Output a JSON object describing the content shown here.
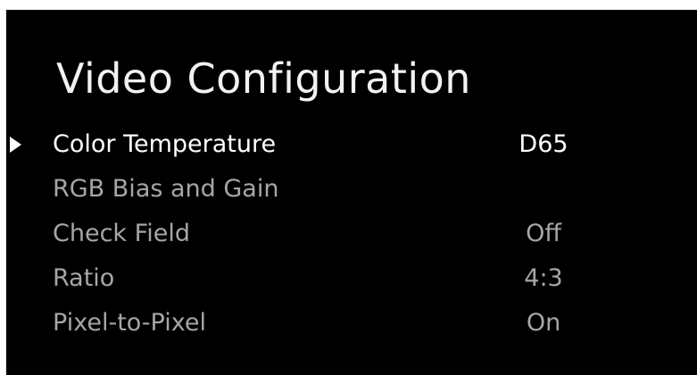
{
  "title": "Video Configuration",
  "menu": {
    "items": [
      {
        "label": "Color Temperature",
        "value": "D65",
        "selected": true
      },
      {
        "label": "RGB Bias and Gain",
        "value": "",
        "selected": false
      },
      {
        "label": "Check Field",
        "value": "Off",
        "selected": false
      },
      {
        "label": "Ratio",
        "value": "4:3",
        "selected": false
      },
      {
        "label": "Pixel-to-Pixel",
        "value": "On",
        "selected": false
      }
    ]
  },
  "colors": {
    "background": "#000000",
    "selected_text": "#ffffff",
    "unselected_text": "#a6a6a6"
  },
  "icons": {
    "selection_pointer": "play-triangle-right-icon"
  }
}
